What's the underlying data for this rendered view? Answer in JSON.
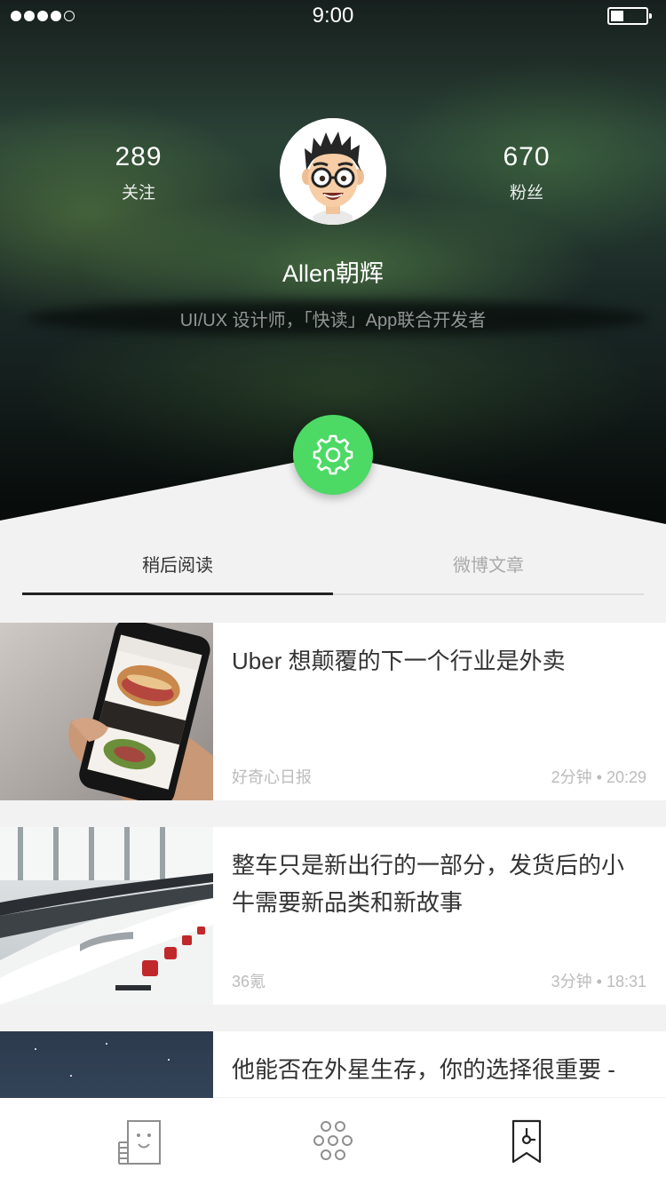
{
  "status_bar": {
    "time": "9:00",
    "signal_bars": 5,
    "signal_filled": 4
  },
  "profile": {
    "following_count": "289",
    "following_label": "关注",
    "followers_count": "670",
    "followers_label": "粉丝",
    "name": "Allen朝辉",
    "bio": "UI/UX 设计师，「快读」App联合开发者"
  },
  "colors": {
    "accent": "#4cd964",
    "text_primary": "#333333",
    "text_muted": "#bbbbbb"
  },
  "tabs": [
    {
      "label": "稍后阅读",
      "active": true
    },
    {
      "label": "微博文章",
      "active": false
    }
  ],
  "articles": [
    {
      "title": "Uber 想颠覆的下一个行业是外卖",
      "source": "好奇心日报",
      "meta": "2分钟 • 20:29"
    },
    {
      "title": "整车只是新出行的一部分，发货后的小牛需要新品类和新故事",
      "source": "36氪",
      "meta": "3分钟 • 18:31"
    },
    {
      "title": "他能否在外星生存，你的选择很重要 - Lifeline #iOS",
      "source": "",
      "meta": ""
    }
  ],
  "tab_bar": [
    {
      "icon": "reader-face-icon"
    },
    {
      "icon": "dots-grid-icon"
    },
    {
      "icon": "bookmark-clock-icon",
      "active": true
    }
  ]
}
